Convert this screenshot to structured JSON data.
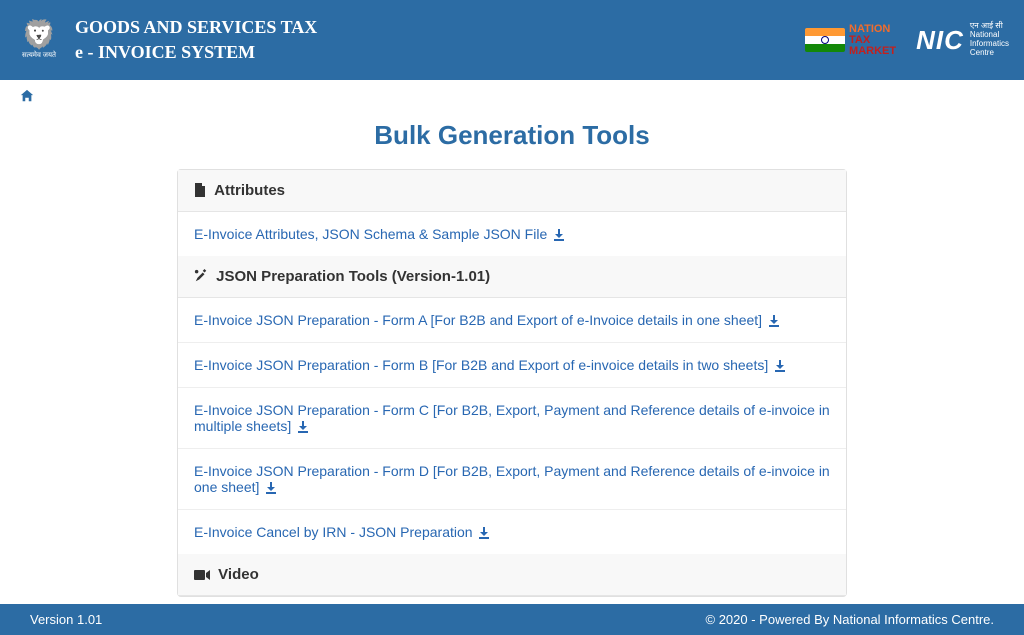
{
  "header": {
    "title_line1": "GOODS AND SERVICES TAX",
    "title_line2": "e - INVOICE SYSTEM",
    "emblem_motto": "सत्यमेव जयते",
    "one_nation_line1": "NATION",
    "one_nation_line2": "TAX",
    "one_nation_line3": "MARKET",
    "nic_abbr": "NIC",
    "nic_hindi": "एन आई सी",
    "nic_full_1": "National",
    "nic_full_2": "Informatics",
    "nic_full_3": "Centre"
  },
  "page": {
    "title": "Bulk Generation Tools"
  },
  "sections": {
    "attributes_header": "Attributes",
    "attributes_link": "E-Invoice Attributes, JSON Schema & Sample JSON File",
    "json_header": "JSON Preparation Tools (Version-1.01)",
    "json_links": [
      "E-Invoice JSON Preparation - Form A [For B2B and Export of e-Invoice details in one sheet]",
      "E-Invoice JSON Preparation - Form B [For B2B and Export of e-invoice details in two sheets]",
      "E-Invoice JSON Preparation - Form C [For B2B, Export, Payment and Reference details of e-invoice in multiple sheets]",
      "E-Invoice JSON Preparation - Form D [For B2B, Export, Payment and Reference details of e-invoice in one sheet]",
      "E-Invoice Cancel by IRN - JSON Preparation"
    ],
    "video_header": "Video"
  },
  "footer": {
    "version": "Version 1.01",
    "copyright": "© 2020 - Powered By National Informatics Centre."
  }
}
